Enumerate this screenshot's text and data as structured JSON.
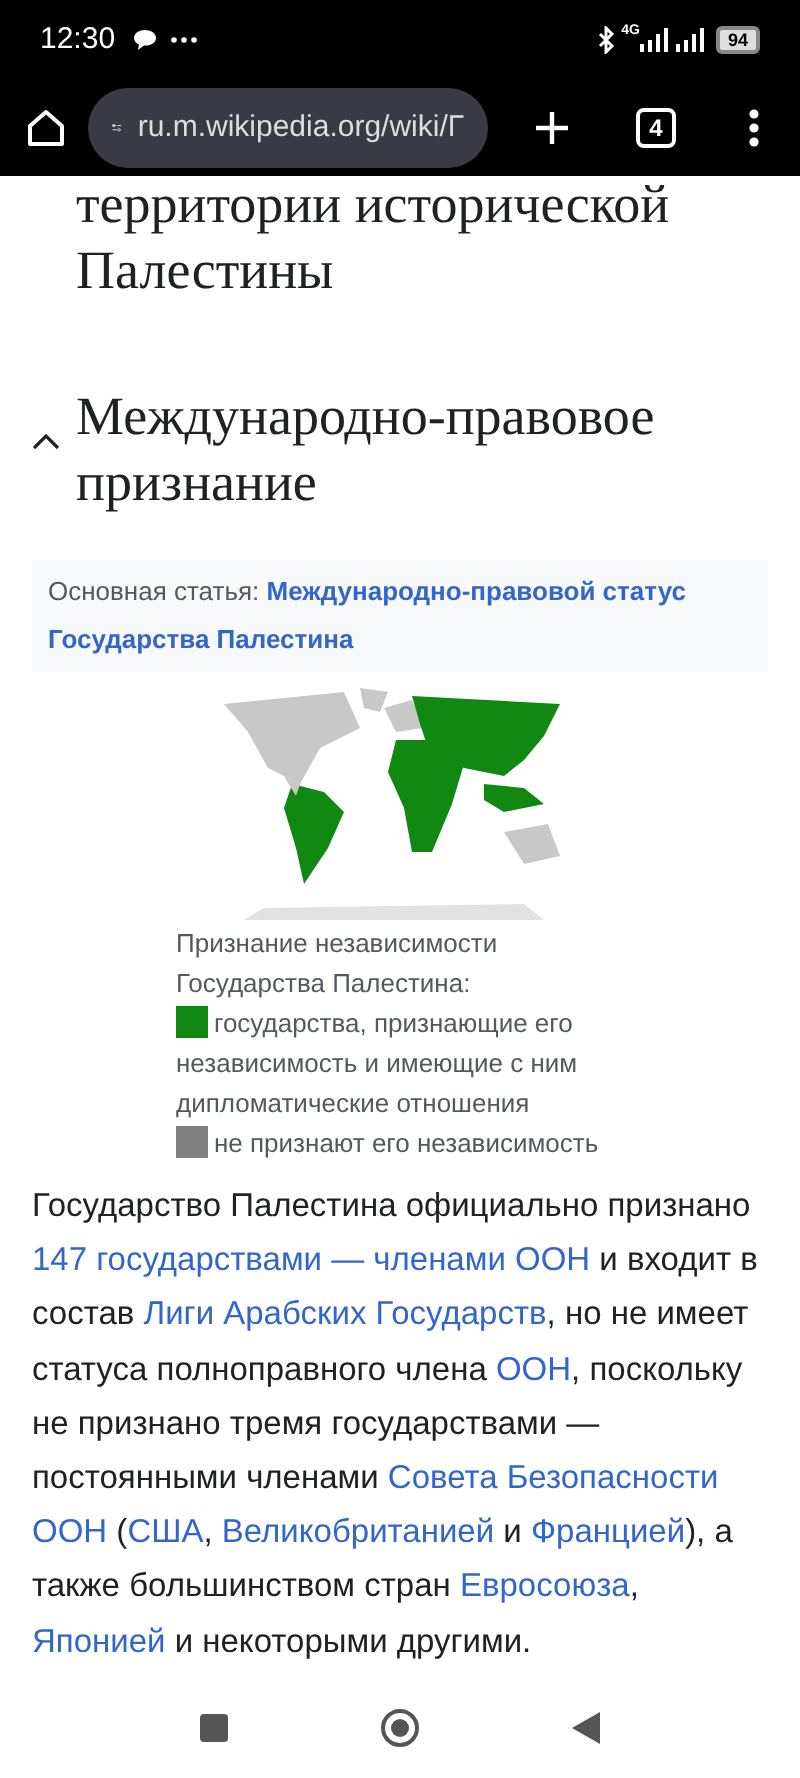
{
  "status_bar": {
    "time": "12:30",
    "network": "4G",
    "battery": "94"
  },
  "browser_toolbar": {
    "url": "ru.m.wikipedia.org/wiki/Г",
    "tab_count": "4"
  },
  "article": {
    "previous_heading": "территории исторической Палестины",
    "section": {
      "title": "Международно-правовое признание",
      "expanded": true
    },
    "hatnote": {
      "label": "Основная статья:",
      "link_lines": [
        "Международно-правовой статус",
        "Государства Палестина"
      ]
    },
    "figure": {
      "kind": "picture",
      "caption": "Признание независимости Государства Палестина:",
      "legend": [
        {
          "color": "#118811",
          "label": "государства, признающие его независимость и имеющие с ним дипломатические отношения"
        },
        {
          "color": "#808080",
          "label": "не признают его независимость"
        }
      ]
    },
    "paragraph": [
      {
        "kind": "text",
        "text": "Государство Палестина официально признано "
      },
      {
        "kind": "link",
        "text": "147 государствами — членами ООН"
      },
      {
        "kind": "text",
        "text": " и входит в состав "
      },
      {
        "kind": "link",
        "text": "Лиги Арабских Государств"
      },
      {
        "kind": "text",
        "text": ", но не имеет статуса полноправного члена "
      },
      {
        "kind": "link",
        "text": "ООН"
      },
      {
        "kind": "text",
        "text": ", поскольку не признано тремя государствами — постоянными членами "
      },
      {
        "kind": "link",
        "text": "Совета Безопасности"
      },
      {
        "kind": "link",
        "text": "ООН"
      },
      {
        "kind": "text",
        "text": " ("
      },
      {
        "kind": "link",
        "text": "США"
      },
      {
        "kind": "text",
        "text": ", "
      },
      {
        "kind": "link",
        "text": "Великобританией"
      },
      {
        "kind": "text",
        "text": " и "
      },
      {
        "kind": "link",
        "text": "Францией"
      },
      {
        "kind": "text",
        "text": "), а также большинством стран "
      },
      {
        "kind": "link",
        "text": "Евросоюза"
      },
      {
        "kind": "text",
        "text": ", "
      },
      {
        "kind": "link",
        "text": "Японией"
      },
      {
        "kind": "text",
        "text": " и некоторыми другими."
      }
    ]
  }
}
